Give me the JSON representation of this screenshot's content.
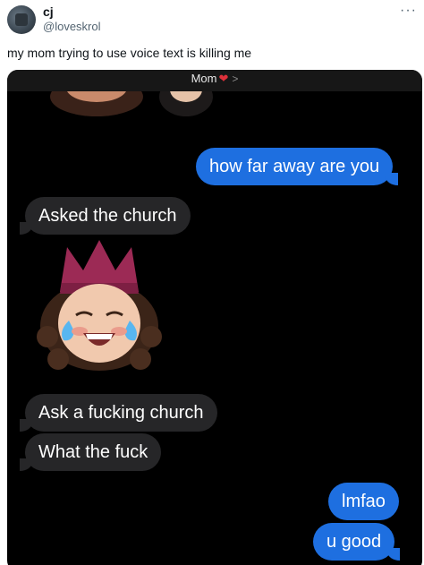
{
  "tweet": {
    "display_name": "cj",
    "handle": "@loveskrol",
    "more_icon": "more-horizontal-icon",
    "text": "my mom trying to use voice text is killing me"
  },
  "chat": {
    "contact_name": "Mom",
    "contact_heart": "❤️",
    "contact_chevron": ">",
    "messages": [
      {
        "side": "sent",
        "text": "how far away are you"
      },
      {
        "side": "received",
        "text": "Asked the church"
      },
      {
        "side": "received",
        "type": "memoji",
        "icon": "crying-laughing-memoji-with-crown"
      },
      {
        "side": "received",
        "text": "Ask a fucking church"
      },
      {
        "side": "received",
        "text": "What the fuck"
      },
      {
        "side": "sent",
        "text": "lmfao"
      },
      {
        "side": "sent",
        "text": "u good"
      }
    ]
  },
  "colors": {
    "sent_bubble": "#1e6fe0",
    "received_bubble": "#262628",
    "chat_background": "#000000",
    "heart": "#e0313b"
  }
}
